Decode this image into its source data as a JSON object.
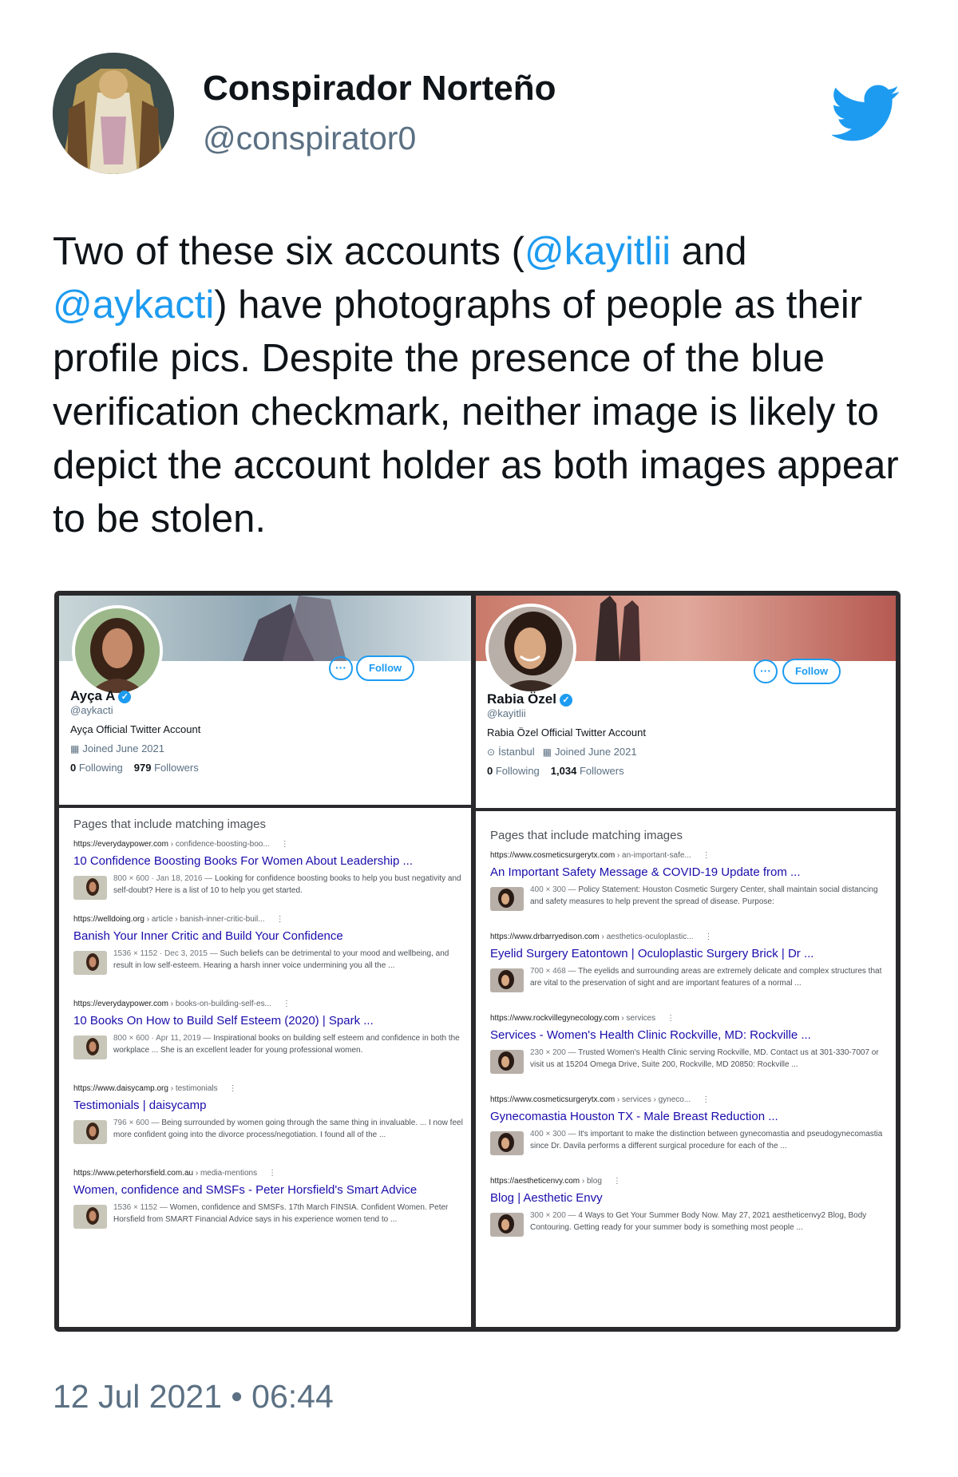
{
  "tweet": {
    "author_name": "Conspirador Norteño",
    "author_handle": "@conspirator0",
    "text_part1": "Two of these six accounts (",
    "mention1": "@kayitlii",
    "text_part2": " and ",
    "mention2": "@aykacti",
    "text_part3": ") have photographs of people as their profile pics. Despite the presence of the blue verification checkmark, neither image is likely to depict the account holder as both images appear to be stolen.",
    "timestamp": "12 Jul 2021 • 06:44",
    "icons": {
      "avatar": "avatar-art",
      "logo": "twitter-bird-icon"
    },
    "colors": {
      "brand": "#1d9bf0",
      "mention": "#1d9bf0",
      "secondary": "#5b7083"
    }
  },
  "profiles": [
    {
      "name": "Ayça A",
      "handle": "@aykacti",
      "bio": "Ayça Official Twitter Account",
      "location": "",
      "joined": "Joined June 2021",
      "following_count": "0",
      "following_label": "Following",
      "followers_count": "979",
      "followers_label": "Followers",
      "more_label": "···",
      "follow_label": "Follow"
    },
    {
      "name": "Rabia Özel",
      "handle": "@kayitlii",
      "bio": "Rabia Özel Official Twitter Account",
      "location": "İstanbul",
      "joined": "Joined June 2021",
      "following_count": "0",
      "following_label": "Following",
      "followers_count": "1,034",
      "followers_label": "Followers",
      "more_label": "···",
      "follow_label": "Follow"
    }
  ],
  "searches": [
    {
      "heading": "Pages that include matching images",
      "results": [
        {
          "domain": "https://everydaypower.com",
          "path": " › confidence-boosting-boo...",
          "title": "10 Confidence Boosting Books For Women About Leadership ...",
          "meta": "800 × 600 · Jan 18, 2016 — ",
          "snippet": "Looking for confidence boosting books to help you bust negativity and self-doubt? Here is a list of 10 to help you get started."
        },
        {
          "domain": "https://welldoing.org",
          "path": " › article › banish-inner-critic-buil...",
          "title": "Banish Your Inner Critic and Build Your Confidence",
          "meta": "1536 × 1152 · Dec 3, 2015 — ",
          "snippet": "Such beliefs can be detrimental to your mood and wellbeing, and result in low self-esteem. Hearing a harsh inner voice undermining you all the ..."
        },
        {
          "domain": "https://everydaypower.com",
          "path": " › books-on-building-self-es...",
          "title": "10 Books On How to Build Self Esteem (2020) | Spark ...",
          "meta": "800 × 600 · Apr 11, 2019 — ",
          "snippet": "Inspirational books on building self esteem and confidence in both the workplace ... She is an excellent leader for young professional women."
        },
        {
          "domain": "https://www.daisycamp.org",
          "path": " › testimonials",
          "title": "Testimonials | daisycamp",
          "meta": "796 × 600 — ",
          "snippet": "Being surrounded by women going through the same thing in invaluable. ... I now feel more confident going into the divorce process/negotiation. I found all of the ..."
        },
        {
          "domain": "https://www.peterhorsfield.com.au",
          "path": " › media-mentions",
          "title": "Women, confidence and SMSFs - Peter Horsfield's Smart Advice",
          "meta": "1536 × 1152 — ",
          "snippet": "Women, confidence and SMSFs. 17th March FINSIA. Confident Women. Peter Horsfield from SMART Financial Advice says in his experience women tend to ..."
        }
      ]
    },
    {
      "heading": "Pages that include matching images",
      "results": [
        {
          "domain": "https://www.cosmeticsurgerytx.com",
          "path": " › an-important-safe...",
          "title": "An Important Safety Message & COVID-19 Update from ...",
          "meta": "400 × 300 — ",
          "snippet": "Policy Statement: Houston Cosmetic Surgery Center, shall maintain social distancing and safety measures to help prevent the spread of disease. Purpose:"
        },
        {
          "domain": "https://www.drbarryedison.com",
          "path": " › aesthetics-oculoplastic...",
          "title": "Eyelid Surgery Eatontown | Oculoplastic Surgery Brick | Dr ...",
          "meta": "700 × 468 — ",
          "snippet": "The eyelids and surrounding areas are extremely delicate and complex structures that are vital to the preservation of sight and are important features of a normal ..."
        },
        {
          "domain": "https://www.rockvillegynecology.com",
          "path": " › services",
          "title": "Services - Women's Health Clinic Rockville, MD: Rockville ...",
          "meta": "230 × 200 — ",
          "snippet": "Trusted Women's Health Clinic serving Rockville, MD. Contact us at 301-330-7007 or visit us at 15204 Omega Drive, Suite 200, Rockville, MD 20850: Rockville ..."
        },
        {
          "domain": "https://www.cosmeticsurgerytx.com",
          "path": " › services › gyneco...",
          "title": "Gynecomastia Houston TX - Male Breast Reduction ...",
          "meta": "400 × 300 — ",
          "snippet": "It's important to make the distinction between gynecomastia and pseudogynecomastia since Dr. Davila performs a different surgical procedure for each of the ..."
        },
        {
          "domain": "https://aestheticenvy.com",
          "path": " › blog",
          "title": "Blog | Aesthetic Envy",
          "meta": "300 × 200 — ",
          "snippet": "4 Ways to Get Your Summer Body Now. May 27, 2021 aestheticenvy2 Blog, Body Contouring. Getting ready for your summer body is something most people ..."
        }
      ]
    }
  ]
}
